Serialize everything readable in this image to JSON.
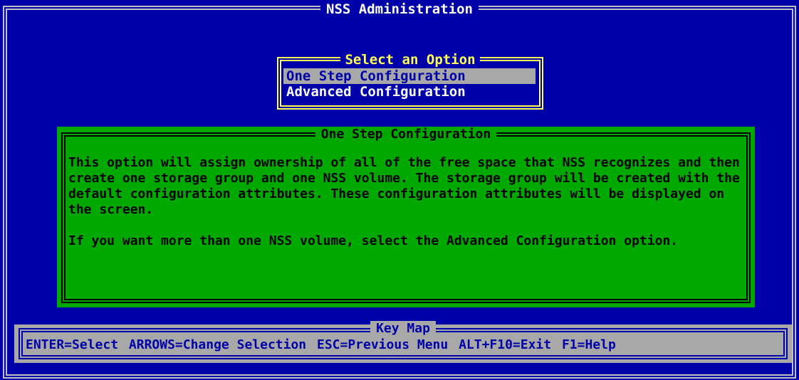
{
  "window": {
    "title": "NSS Administration"
  },
  "menu": {
    "title": "Select an Option",
    "items": [
      {
        "label": "One Step Configuration",
        "selected": true
      },
      {
        "label": "Advanced Configuration",
        "selected": false
      }
    ]
  },
  "info": {
    "title": "One Step Configuration",
    "paragraph1": "This option will assign ownership of all of the free space that NSS recognizes and then create one storage group and one NSS volume. The storage group will be created with the default configuration attributes. These configuration attributes will be displayed on the screen.",
    "paragraph2": "If you want more than one NSS volume, select the Advanced Configuration option."
  },
  "keymap": {
    "title": "Key Map",
    "keys": [
      "ENTER=Select",
      "ARROWS=Change Selection",
      "ESC=Previous Menu",
      "ALT+F10=Exit",
      "F1=Help"
    ]
  },
  "colors": {
    "background": "#0000a8",
    "menu_border": "#ffff54",
    "info_background": "#00a800",
    "keymap_background": "#a8a8a8"
  }
}
